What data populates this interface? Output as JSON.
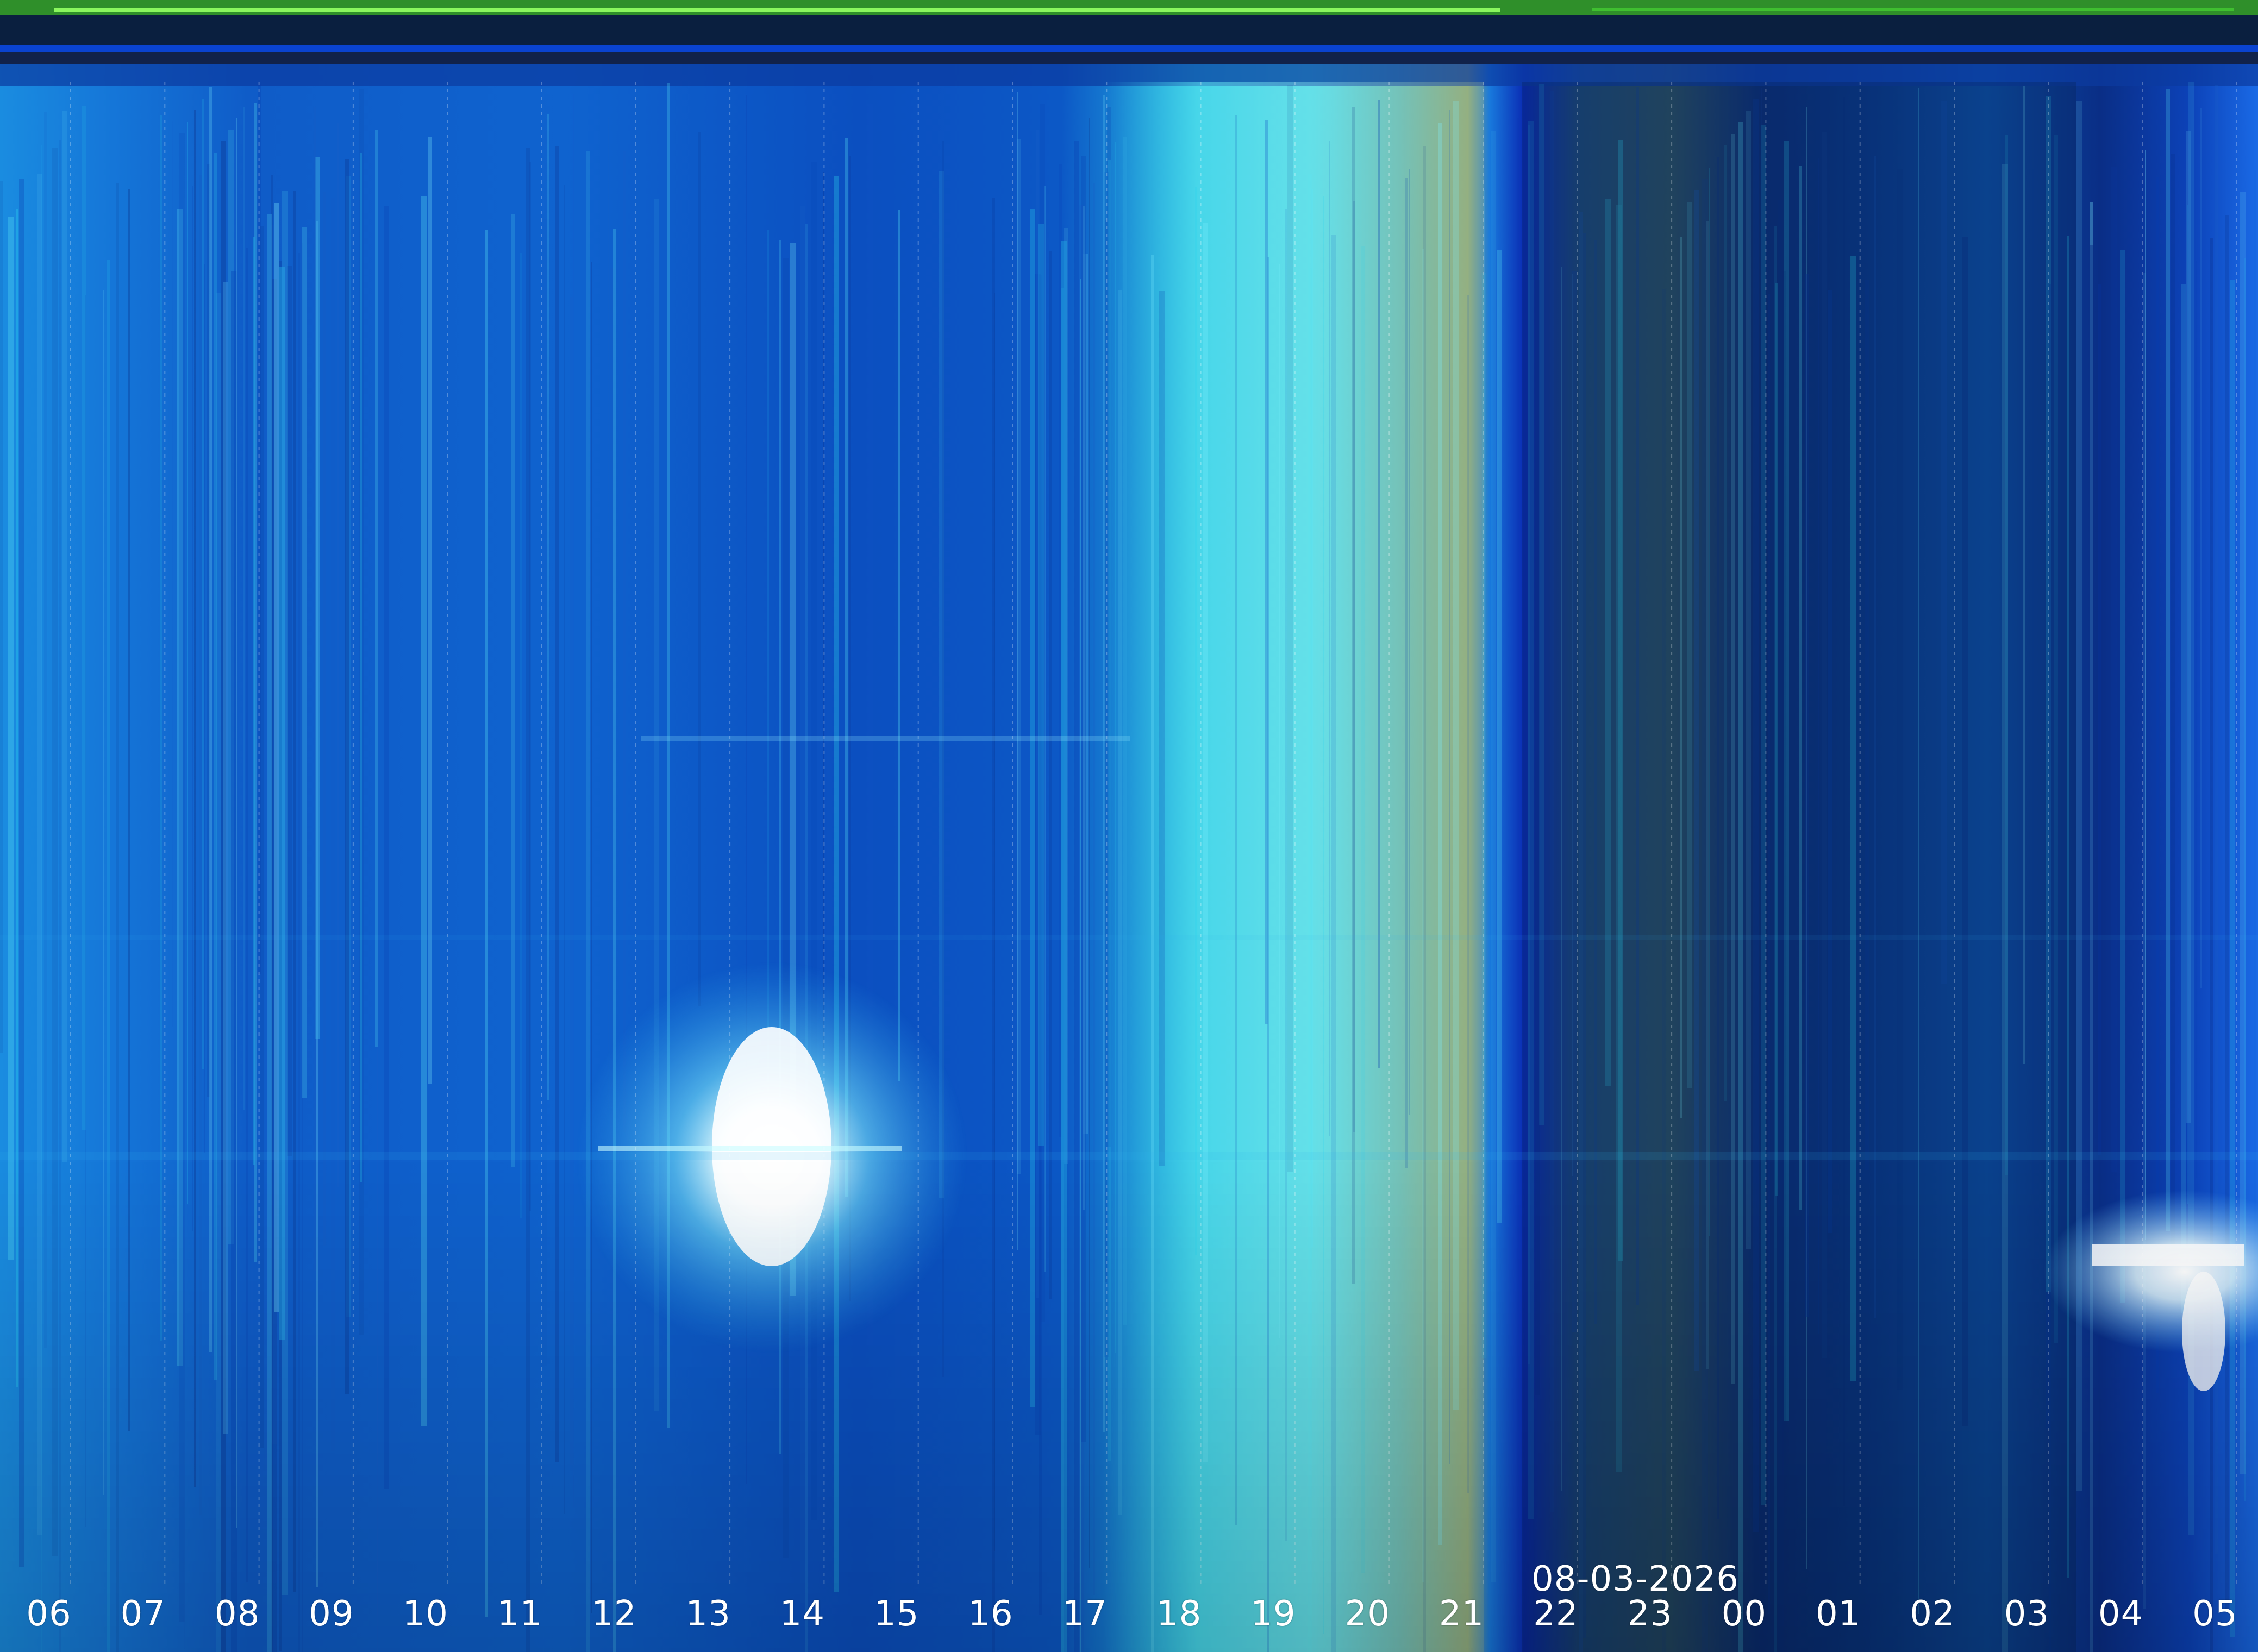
{
  "image": {
    "kind": "all-sky camera keogram",
    "timeline_date": "08-03-2026",
    "hours": [
      "06",
      "07",
      "08",
      "09",
      "10",
      "11",
      "12",
      "13",
      "14",
      "15",
      "16",
      "17",
      "18",
      "19",
      "20",
      "21",
      "22",
      "23",
      "00",
      "01",
      "02",
      "03",
      "04",
      "05"
    ]
  },
  "colors": {
    "sky_blue": "#1e7fe6",
    "deep_blue": "#0b2fb8",
    "cyan_glow": "#2fd6f0",
    "teal_dusk": "#5aa8a0",
    "night_navy": "#06205a",
    "top_strip_green": "#3a9a2a",
    "top_strip_line": "#86f25a",
    "label_white": "#ffffff"
  },
  "scene": {
    "sun": "bright sun flare near 13-14h",
    "moon": "bright moonlight near 04-05h",
    "sunset_band": "cyan twilight band 17-21h"
  }
}
